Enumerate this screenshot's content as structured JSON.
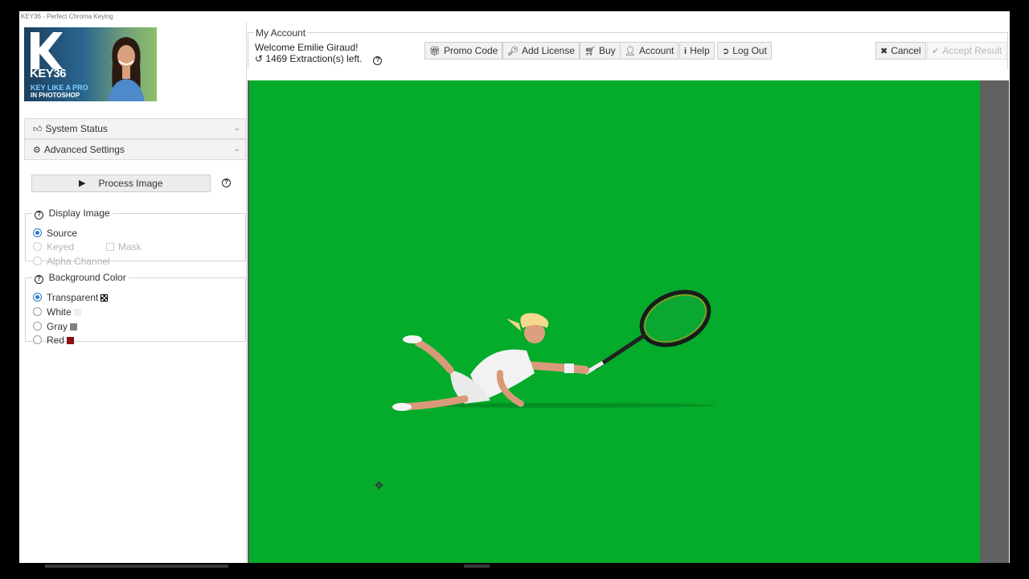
{
  "window": {
    "title": "KEY36 - Perfect Chroma Keying"
  },
  "logo": {
    "brand": "KEY36",
    "tagline_1": "KEY LIKE A PRO",
    "tagline_2": "IN PHOTOSHOP"
  },
  "sidebar": {
    "accordions": [
      {
        "label": "System Status",
        "icon": "thumbs-up-icon"
      },
      {
        "label": "Advanced Settings",
        "icon": "gear-icon"
      }
    ],
    "process_button": "Process Image",
    "display_image": {
      "title": "Display Image",
      "options": [
        {
          "label": "Source",
          "selected": true,
          "enabled": true
        },
        {
          "label": "Keyed",
          "selected": false,
          "enabled": false
        },
        {
          "label": "Alpha Channel",
          "selected": false,
          "enabled": false
        }
      ],
      "mask_checkbox": {
        "label": "Mask",
        "checked": false,
        "enabled": false
      }
    },
    "background_color": {
      "title": "Background Color",
      "options": [
        {
          "label": "Transparent",
          "selected": true,
          "swatch": "checker"
        },
        {
          "label": "White",
          "selected": false,
          "swatch": "#eeeeee"
        },
        {
          "label": "Gray",
          "selected": false,
          "swatch": "#808080"
        },
        {
          "label": "Red",
          "selected": false,
          "swatch": "#8b1111"
        }
      ]
    }
  },
  "account": {
    "title": "My Account",
    "welcome": "Welcome Emilie Giraud!",
    "extractions": "1469 Extraction(s) left.",
    "buttons": {
      "promo": "Promo Code",
      "license": "Add License",
      "buy": "Buy",
      "account": "Account",
      "help": "Help",
      "logout": "Log Out",
      "cancel": "Cancel",
      "accept": "Accept Result"
    }
  },
  "colors": {
    "canvas_green": "#05ab2b",
    "accent": "#2b78c5",
    "gutter": "#606060"
  }
}
